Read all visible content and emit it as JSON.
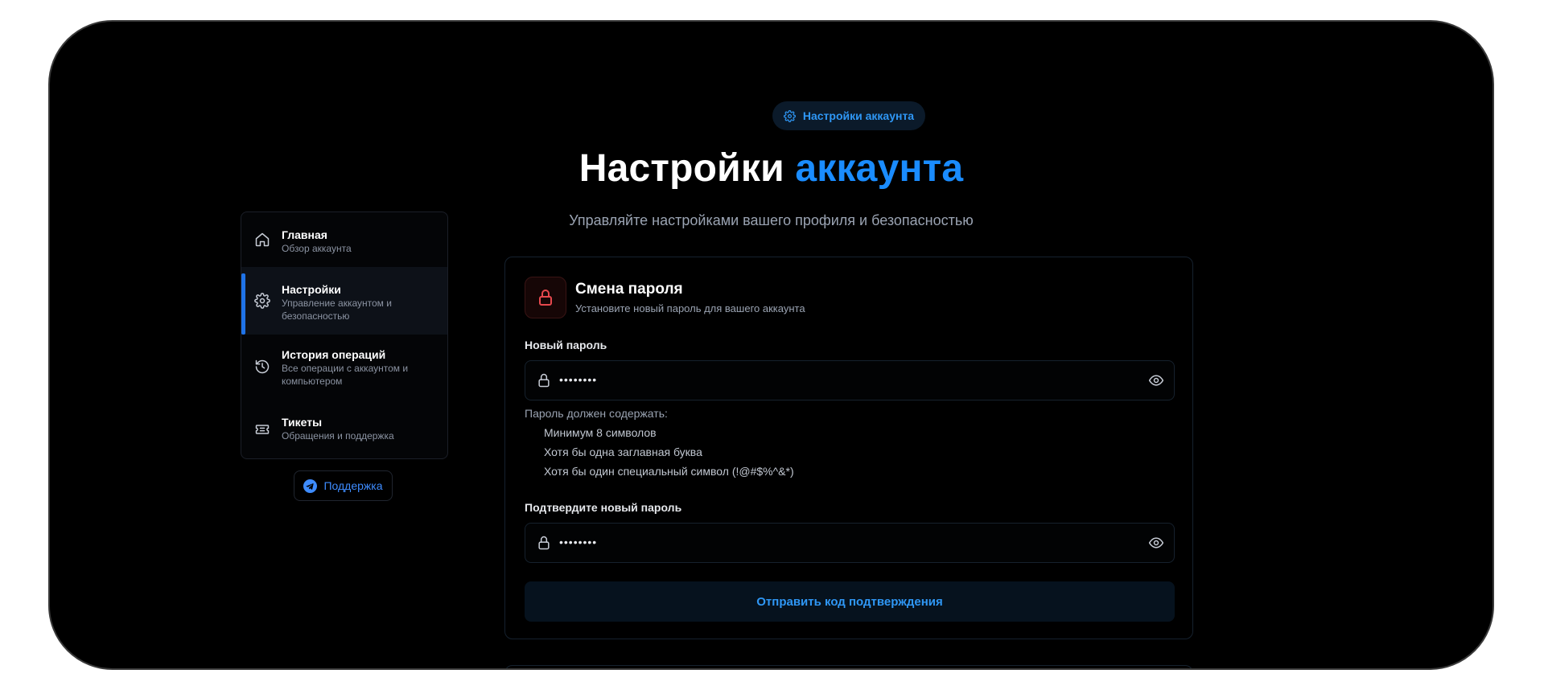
{
  "header": {
    "pill_label": "Настройки аккаунта",
    "title_main": "Настройки",
    "title_accent": "аккаунта",
    "subtitle": "Управляйте настройками вашего профиля и безопасностью"
  },
  "sidebar": {
    "items": [
      {
        "title": "Главная",
        "desc": "Обзор аккаунта",
        "icon": "home-icon",
        "active": false
      },
      {
        "title": "Настройки",
        "desc": "Управление аккаунтом и безопасностью",
        "icon": "gear-icon",
        "active": true
      },
      {
        "title": "История операций",
        "desc": "Все операции с аккаунтом и компьютером",
        "icon": "history-icon",
        "active": false
      },
      {
        "title": "Тикеты",
        "desc": "Обращения и поддержка",
        "icon": "ticket-icon",
        "active": false
      }
    ],
    "support_label": "Поддержка"
  },
  "password_card": {
    "title": "Смена пароля",
    "subtitle": "Установите новый пароль для вашего аккаунта",
    "new_password_label": "Новый пароль",
    "new_password_value": "••••••••",
    "requirements_title": "Пароль должен содержать:",
    "requirements": [
      "Минимум 8 символов",
      "Хотя бы одна заглавная буква",
      "Хотя бы один специальный символ (!@#$%^&*)"
    ],
    "confirm_label": "Подтвердите новый пароль",
    "confirm_value": "••••••••",
    "submit_label": "Отправить код подтверждения"
  },
  "colors": {
    "accent": "#1a8cff",
    "background": "#000000",
    "lock_accent": "#e5484d"
  }
}
